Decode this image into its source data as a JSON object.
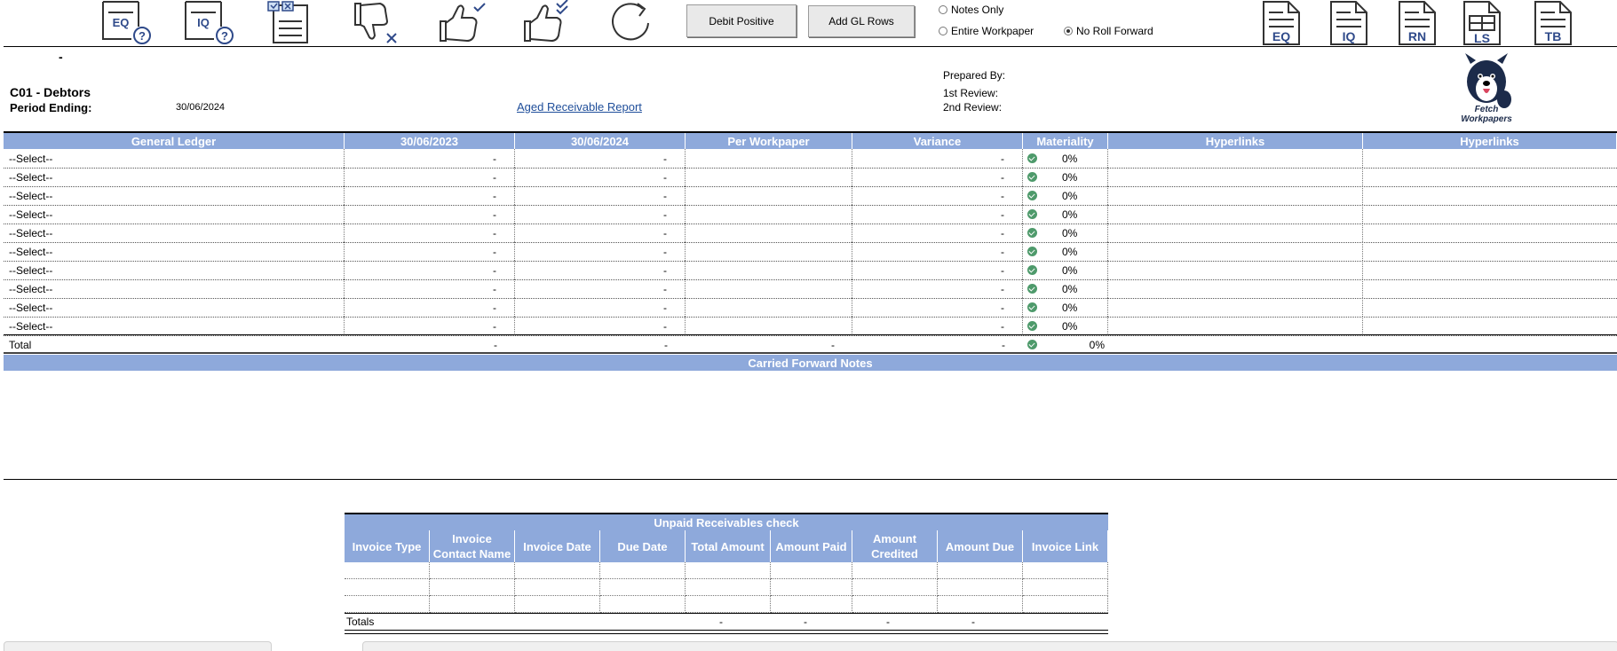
{
  "toolbar": {
    "icons": [
      {
        "name": "eq-help-icon",
        "label": "EQ"
      },
      {
        "name": "iq-help-icon",
        "label": "IQ"
      },
      {
        "name": "checklist-doc-icon",
        "label": ""
      },
      {
        "name": "thumbs-down-icon",
        "label": ""
      },
      {
        "name": "thumbs-up-check-icon",
        "label": ""
      },
      {
        "name": "thumbs-up-double-check-icon",
        "label": ""
      },
      {
        "name": "refresh-icon",
        "label": ""
      }
    ],
    "debit_positive_label": "Debit Positive",
    "add_gl_rows_label": "Add GL Rows",
    "radio_notes_only": "Notes Only",
    "radio_entire_workpaper": "Entire Workpaper",
    "radio_no_roll_forward": "No Roll Forward",
    "selected_radio": "No Roll Forward",
    "doc_icons": [
      "EQ",
      "IQ",
      "RN",
      "LS",
      "TB"
    ]
  },
  "header": {
    "dash": "-",
    "title": "C01 - Debtors",
    "period_label": "Period Ending:",
    "period_value": "30/06/2024",
    "report_link": "Aged Receivable Report",
    "prepared_by": "Prepared By:",
    "first_review": "1st Review:",
    "second_review": "2nd Review:",
    "logo_text": "Fetch Workpapers"
  },
  "grid": {
    "columns": [
      "General Ledger",
      "30/06/2023",
      "30/06/2024",
      "Per Workpaper",
      "Variance",
      "Materiality",
      "Hyperlinks",
      "Hyperlinks"
    ],
    "rows": [
      {
        "gl": "--Select--",
        "p2023": "-",
        "p2024": "-",
        "per_wp": "",
        "variance": "-",
        "materiality": "0%"
      },
      {
        "gl": "--Select--",
        "p2023": "-",
        "p2024": "-",
        "per_wp": "",
        "variance": "-",
        "materiality": "0%"
      },
      {
        "gl": "--Select--",
        "p2023": "-",
        "p2024": "-",
        "per_wp": "",
        "variance": "-",
        "materiality": "0%"
      },
      {
        "gl": "--Select--",
        "p2023": "-",
        "p2024": "-",
        "per_wp": "",
        "variance": "-",
        "materiality": "0%"
      },
      {
        "gl": "--Select--",
        "p2023": "-",
        "p2024": "-",
        "per_wp": "",
        "variance": "-",
        "materiality": "0%"
      },
      {
        "gl": "--Select--",
        "p2023": "-",
        "p2024": "-",
        "per_wp": "",
        "variance": "-",
        "materiality": "0%"
      },
      {
        "gl": "--Select--",
        "p2023": "-",
        "p2024": "-",
        "per_wp": "",
        "variance": "-",
        "materiality": "0%"
      },
      {
        "gl": "--Select--",
        "p2023": "-",
        "p2024": "-",
        "per_wp": "",
        "variance": "-",
        "materiality": "0%"
      },
      {
        "gl": "--Select--",
        "p2023": "-",
        "p2024": "-",
        "per_wp": "",
        "variance": "-",
        "materiality": "0%"
      },
      {
        "gl": "--Select--",
        "p2023": "-",
        "p2024": "-",
        "per_wp": "",
        "variance": "-",
        "materiality": "0%"
      }
    ],
    "total": {
      "label": "Total",
      "p2023": "-",
      "p2024": "-",
      "per_wp": "-",
      "variance": "-",
      "materiality": "0%"
    },
    "notes_title": "Carried Forward Notes"
  },
  "unpaid": {
    "title": "Unpaid Receivables check",
    "columns": [
      "Invoice Type",
      "Invoice Contact Name",
      "Invoice Date",
      "Due Date",
      "Total Amount",
      "Amount Paid",
      "Amount Credited",
      "Amount Due",
      "Invoice Link"
    ],
    "totals_label": "Totals",
    "totals": [
      "-",
      "-",
      "-",
      "-"
    ]
  },
  "colors": {
    "header_blue": "#8ea9db",
    "check_green": "#4e9a6b",
    "link_blue": "#1f4e9a"
  }
}
